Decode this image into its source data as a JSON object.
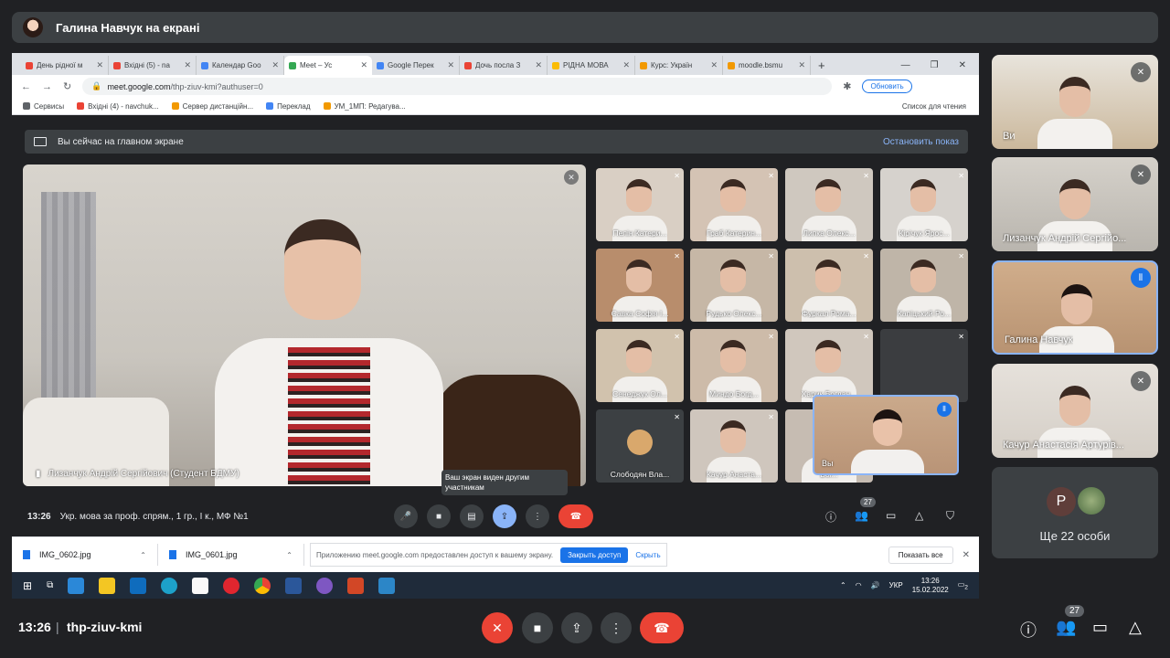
{
  "presenter_bar": {
    "title": "Галина Навчук на екрані"
  },
  "browser": {
    "tabs": [
      {
        "label": "День рідної м",
        "color": "#ea4335"
      },
      {
        "label": "Вхідні (5) - na",
        "color": "#ea4335"
      },
      {
        "label": "Календар Goo",
        "color": "#4285f4"
      },
      {
        "label": "Meet – Ус",
        "color": "#34a853",
        "active": true
      },
      {
        "label": "Google Перек",
        "color": "#4285f4"
      },
      {
        "label": "Дочь посла З",
        "color": "#ea4335"
      },
      {
        "label": "РІДНА МОВА",
        "color": "#fbbc04"
      },
      {
        "label": "Курс: Україн",
        "color": "#f29900"
      },
      {
        "label": "moodle.bsmu",
        "color": "#f29900"
      }
    ],
    "url_host": "meet.google.com",
    "url_path": "/thp-ziuv-kmi?authuser=0",
    "update_label": "Обновить",
    "bookmarks": [
      {
        "label": "Сервисы",
        "color": "#5f6368"
      },
      {
        "label": "Вхідні (4) - navchuk...",
        "color": "#ea4335"
      },
      {
        "label": "Сервер дистанційн...",
        "color": "#f29900"
      },
      {
        "label": "Переклад",
        "color": "#4285f4"
      },
      {
        "label": "УМ_1МП: Редагува...",
        "color": "#f29900"
      }
    ],
    "reading_list": "Список для чтения"
  },
  "inner_meet": {
    "banner_text": "Вы сейчас на главном экране",
    "banner_stop": "Остановить показ",
    "main_speaker": "Лизанчук Андрій Сергійович (Студент БДМУ)",
    "grid": [
      "Пелін Катери...",
      "Граб Катерин...",
      "Липка Олекс...",
      "Кірічук Ярос...",
      "Савка Софія І...",
      "Рудько Олекс...",
      "Фуркал Рома...",
      "Капіцький Ро...",
      "Сенеджук Ол...",
      "Миндо Богд...",
      "Харик Богдан...",
      "",
      "Слободян Вла...",
      "Качур Анаста...",
      "Бог..."
    ],
    "self_label": "Вы",
    "tooltip": "Ваш экран виден другим участникам",
    "time": "13:26",
    "meeting_title": "Укр. мова за проф. спрям., 1 гр., І к., МФ №1",
    "participants_count": "27"
  },
  "downloads": {
    "files": [
      "IMG_0602.jpg",
      "IMG_0601.jpg"
    ],
    "notice": "Приложению meet.google.com предоставлен доступ к вашему экрану.",
    "close_access": "Закрыть доступ",
    "hide": "Скрыть",
    "show_all": "Показать все"
  },
  "taskbar": {
    "lang": "УКР",
    "time": "13:26",
    "date": "15.02.2022",
    "notif": "2"
  },
  "right_panel": {
    "tiles": [
      "Ви",
      "Лизанчук Андрій Сергійо...",
      "Галина Навчук",
      "Качур Анастасія Артурів..."
    ],
    "more_initial": "P",
    "more_label": "Ще 22 особи"
  },
  "bottom_bar": {
    "time": "13:26",
    "separator": "|",
    "code": "thp-ziuv-kmi",
    "participants_count": "27"
  }
}
